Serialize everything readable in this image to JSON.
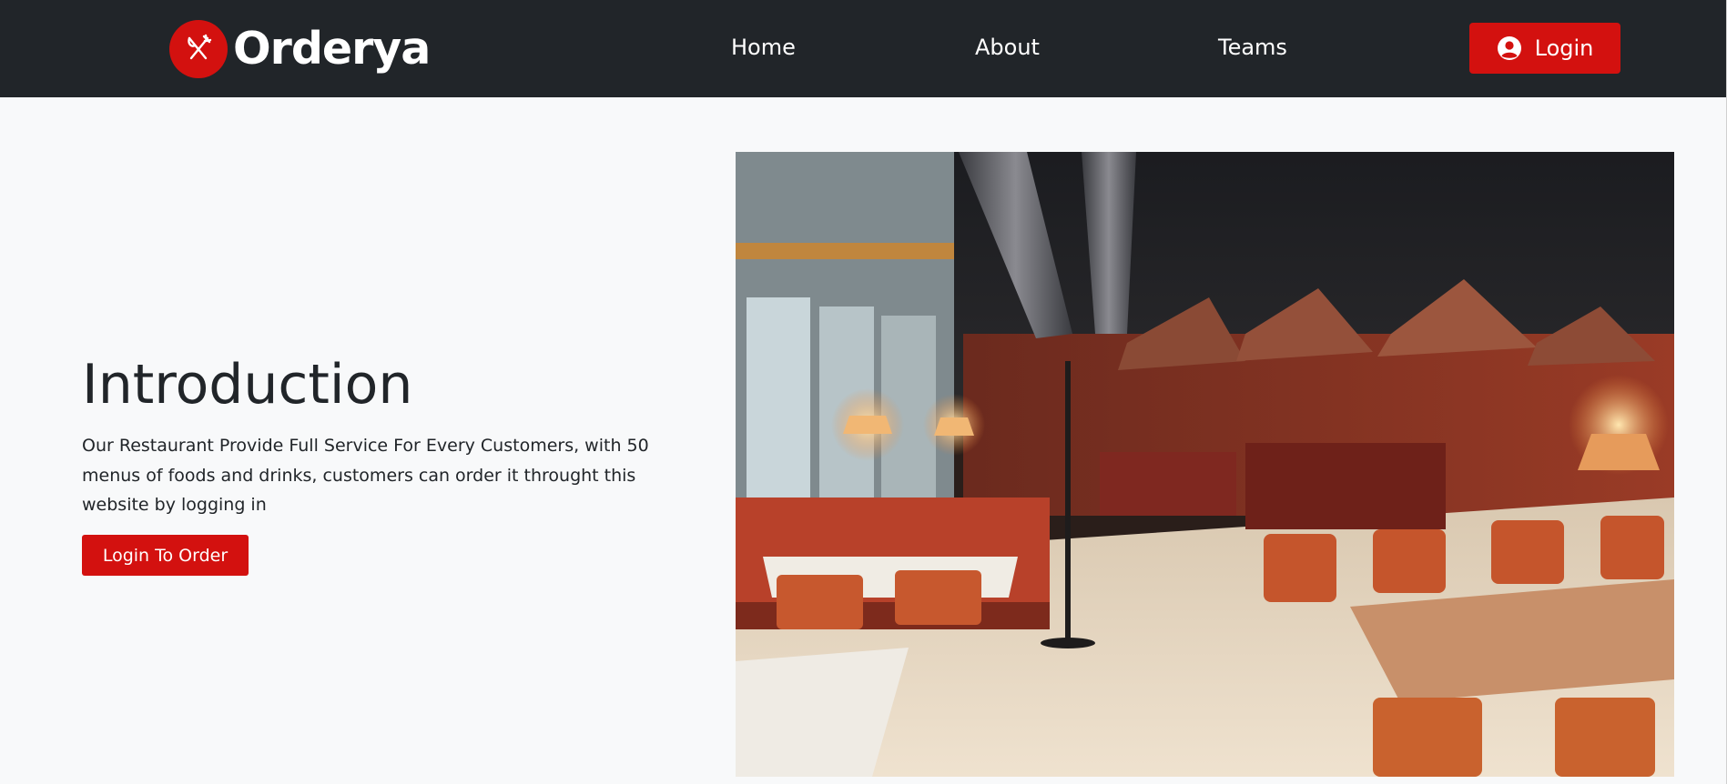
{
  "brand": {
    "name": "Orderya",
    "logo_icon": "fork-knife-icon",
    "accent": "#d3110f"
  },
  "nav": {
    "items": [
      {
        "label": "Home"
      },
      {
        "label": "About"
      },
      {
        "label": "Teams"
      }
    ],
    "login_label": "Login",
    "login_icon": "user-circle-icon",
    "background": "#212529"
  },
  "hero": {
    "title": "Introduction",
    "description": "Our Restaurant Provide Full Service For Every Customers, with 50 menus of foods and drinks, customers can order it throught this website by logging in",
    "cta_label": "Login To Order",
    "image_subject": "restaurant interior"
  }
}
